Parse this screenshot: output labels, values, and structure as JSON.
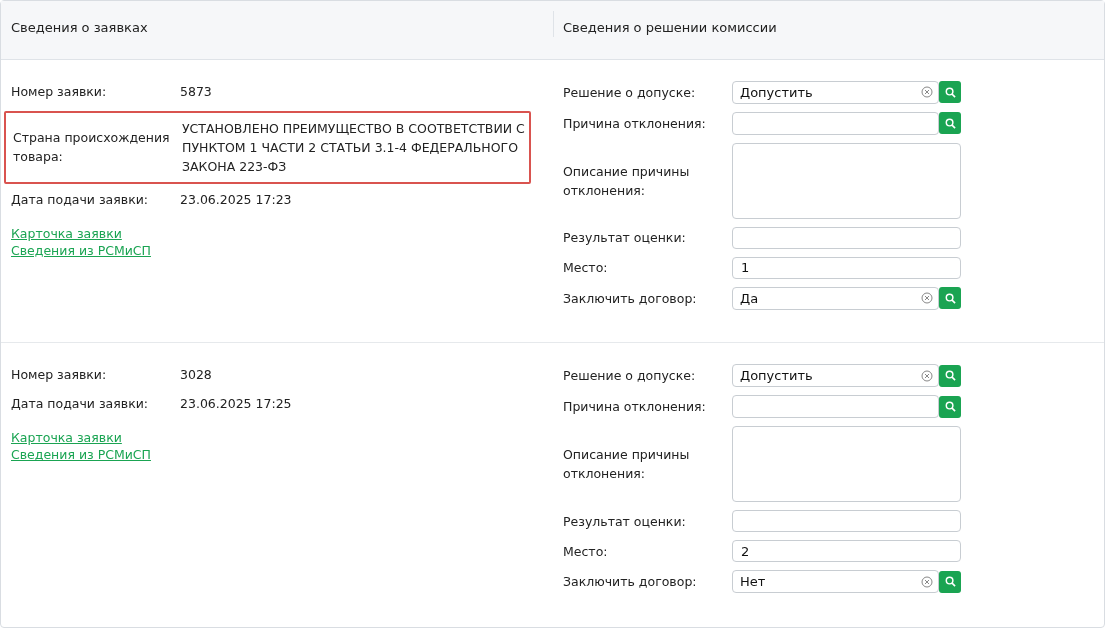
{
  "header": {
    "left_title": "Сведения о заявках",
    "right_title": "Сведения о решении комиссии"
  },
  "applications": [
    {
      "info": [
        {
          "label": "Номер заявки:",
          "value": "5873",
          "highlighted": false
        },
        {
          "label": "Страна происхождения товара:",
          "value": "УСТАНОВЛЕНО ПРЕИМУЩЕСТВО В СООТВЕТСТВИИ С ПУНКТОМ 1 ЧАСТИ 2 СТАТЬИ 3.1-4 ФЕДЕРАЛЬНОГО ЗАКОНА 223-ФЗ",
          "highlighted": true
        },
        {
          "label": "Дата подачи заявки:",
          "value": "23.06.2025 17:23",
          "highlighted": false
        }
      ],
      "links": [
        "Карточка заявки",
        "Сведения из РСМиСП"
      ],
      "decision": [
        {
          "label": "Решение о допуске:",
          "kind": "select",
          "value": "Допустить"
        },
        {
          "label": "Причина отклонения:",
          "kind": "select"
        },
        {
          "label": "Описание причины отклонения:",
          "kind": "textarea"
        },
        {
          "label": "Результат оценки:",
          "kind": "text"
        },
        {
          "label": "Место:",
          "kind": "text",
          "value": "1"
        },
        {
          "label": "Заключить договор:",
          "kind": "select",
          "value": "Да"
        }
      ]
    },
    {
      "info": [
        {
          "label": "Номер заявки:",
          "value": "3028",
          "highlighted": false
        },
        {
          "label": "Дата подачи заявки:",
          "value": "23.06.2025 17:25",
          "highlighted": false
        }
      ],
      "links": [
        "Карточка заявки",
        "Сведения из РСМиСП"
      ],
      "decision": [
        {
          "label": "Решение о допуске:",
          "kind": "select",
          "value": "Допустить"
        },
        {
          "label": "Причина отклонения:",
          "kind": "select"
        },
        {
          "label": "Описание причины отклонения:",
          "kind": "textarea"
        },
        {
          "label": "Результат оценки:",
          "kind": "text"
        },
        {
          "label": "Место:",
          "kind": "text",
          "value": "2"
        },
        {
          "label": "Заключить договор:",
          "kind": "select",
          "value": "Нет"
        }
      ]
    }
  ]
}
